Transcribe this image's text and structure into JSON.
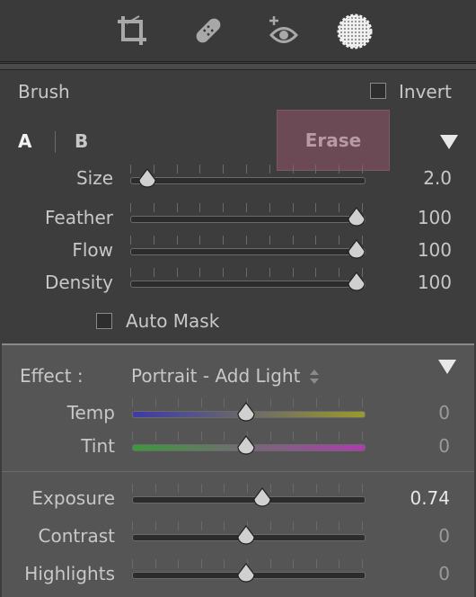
{
  "toolbar": {
    "tools": [
      {
        "name": "crop-icon"
      },
      {
        "name": "healing-brush-icon"
      },
      {
        "name": "red-eye-icon"
      },
      {
        "name": "adjustment-brush-icon",
        "active": true
      }
    ]
  },
  "brush": {
    "title": "Brush",
    "invert_label": "Invert",
    "invert_checked": false,
    "tab_a": "A",
    "tab_b": "B",
    "erase_label": "Erase",
    "auto_mask_label": "Auto Mask",
    "auto_mask_checked": false,
    "sliders": [
      {
        "key": "size",
        "label": "Size",
        "value": "2.0",
        "position": 0.06
      },
      {
        "key": "feather",
        "label": "Feather",
        "value": "100",
        "position": 1.0
      },
      {
        "key": "flow",
        "label": "Flow",
        "value": "100",
        "position": 1.0
      },
      {
        "key": "density",
        "label": "Density",
        "value": "100",
        "position": 1.0
      }
    ]
  },
  "effect": {
    "label": "Effect :",
    "preset": "Portrait - Add Light",
    "sliders": [
      {
        "key": "temp",
        "label": "Temp",
        "value": "0",
        "position": 0.5
      },
      {
        "key": "tint",
        "label": "Tint",
        "value": "0",
        "position": 0.5
      },
      {
        "key": "exposure",
        "label": "Exposure",
        "value": "0.74",
        "position": 0.574
      },
      {
        "key": "contrast",
        "label": "Contrast",
        "value": "0",
        "position": 0.5
      },
      {
        "key": "highlights",
        "label": "Highlights",
        "value": "0",
        "position": 0.5
      }
    ]
  },
  "colors": {
    "temp_gradient": [
      "#3d3aa8",
      "#9a9a2a"
    ],
    "tint_gradient": [
      "#3a9a3a",
      "#b03ab0"
    ],
    "erase_bg": "#6b4a55"
  }
}
